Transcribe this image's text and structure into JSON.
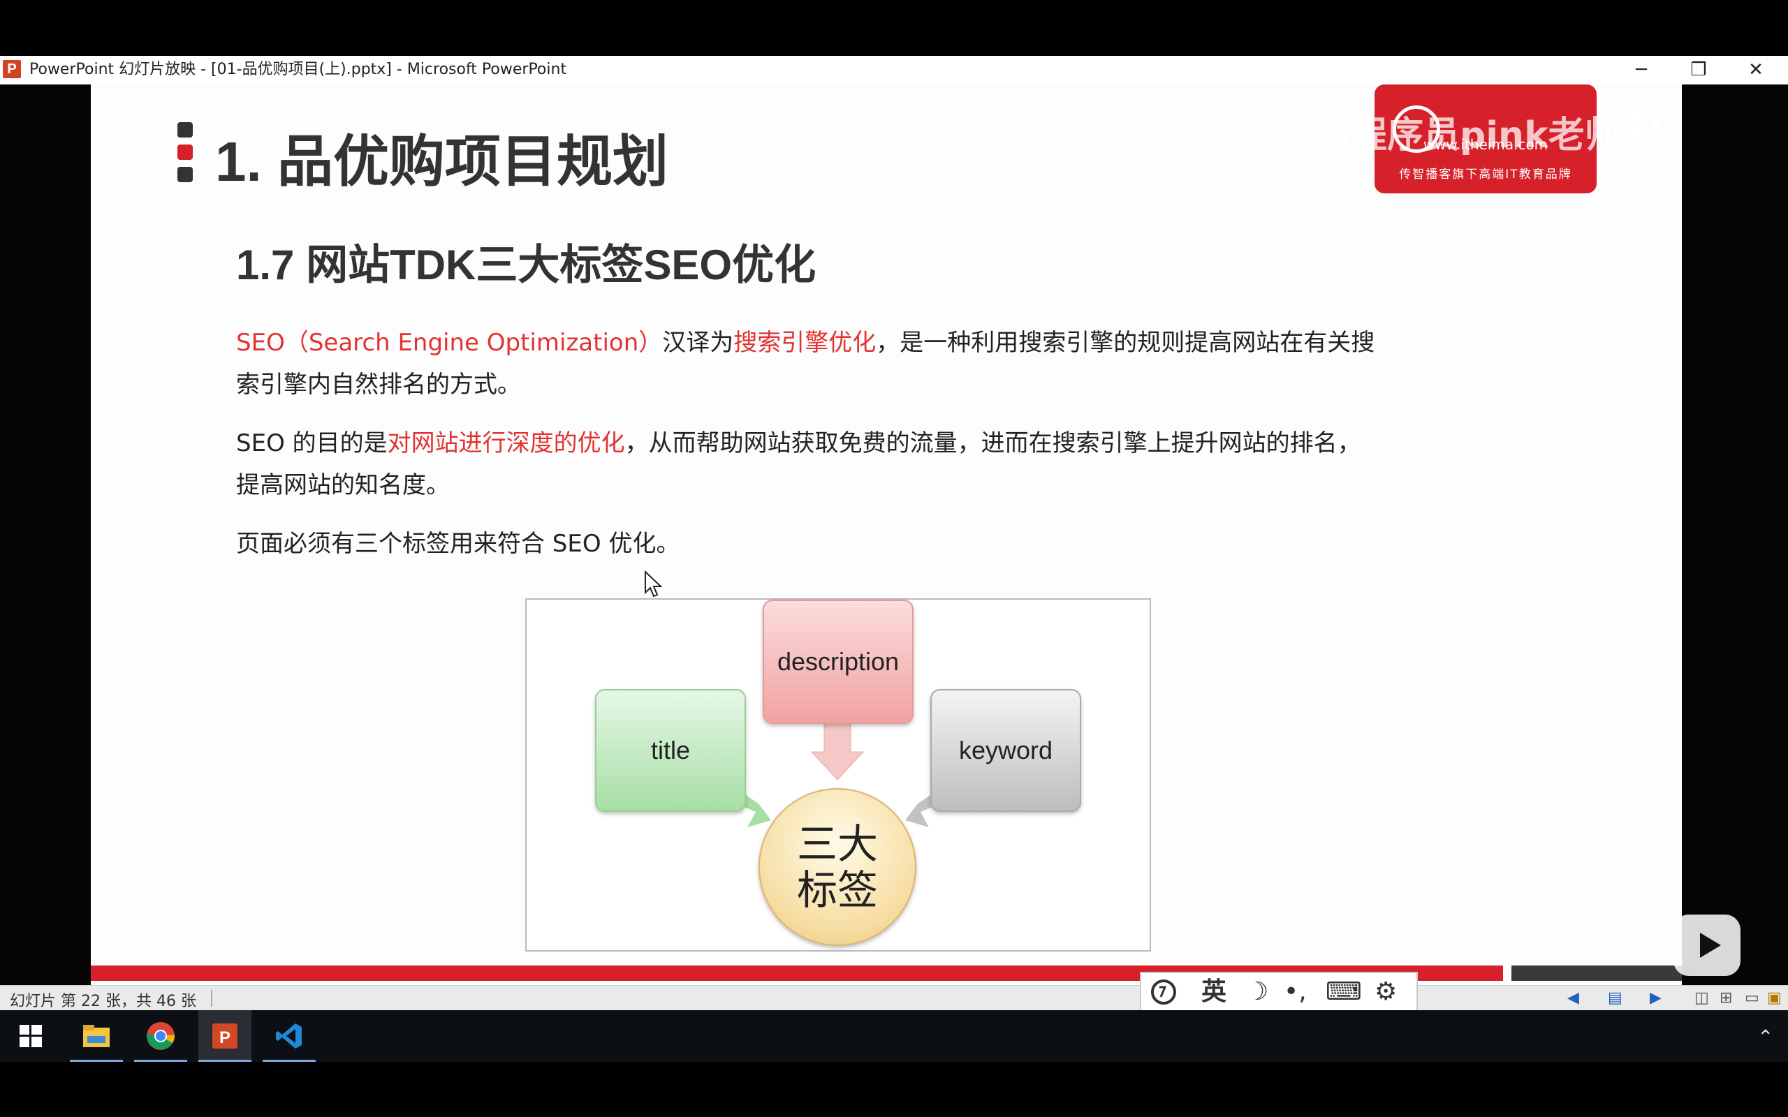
{
  "window": {
    "icon_letter": "P",
    "title": "PowerPoint 幻灯片放映 - [01-品优购项目(上).pptx] - Microsoft PowerPoint",
    "minimize": "─",
    "restore": "❐",
    "close": "✕"
  },
  "slide": {
    "title": "1. 品优购项目规划",
    "subtitle": "1.7 网站TDK三大标签SEO优化",
    "para1": {
      "red1": "SEO（Search Engine Optimization）",
      "text1": "汉译为",
      "red2": "搜索引擎优化",
      "text2": "，是一种利用搜索引擎的规则提高网站在有关搜索引擎内自然排名的方式。"
    },
    "para2": {
      "text1": "SEO 的目的是",
      "red1": "对网站进行深度的优化",
      "text2": "，从而帮助网站获取免费的流量，进而在搜索引擎上提升网站的排名，提高网站的知名度。"
    },
    "para3": "页面必须有三个标签用来符合 SEO 优化。",
    "logo": {
      "url": "www.itheima.com",
      "slogan": "传智播客旗下高端IT教育品牌"
    },
    "watermark": "黑马程序员pink老师",
    "bilibili": "bilibili",
    "diagram": {
      "description": "description",
      "title": "title",
      "keyword": "keyword",
      "center_line1": "三大",
      "center_line2": "标签"
    }
  },
  "statusbar": {
    "slide_info": "幻灯片 第 22 张，共 46 张",
    "ime_lang": "英"
  },
  "colors": {
    "accent_red": "#d6212b",
    "highlight_red": "#e33232"
  },
  "taskbar": {
    "apps": [
      "start-icon",
      "file-explorer-icon",
      "chrome-icon",
      "powerpoint-icon",
      "vscode-icon"
    ]
  }
}
